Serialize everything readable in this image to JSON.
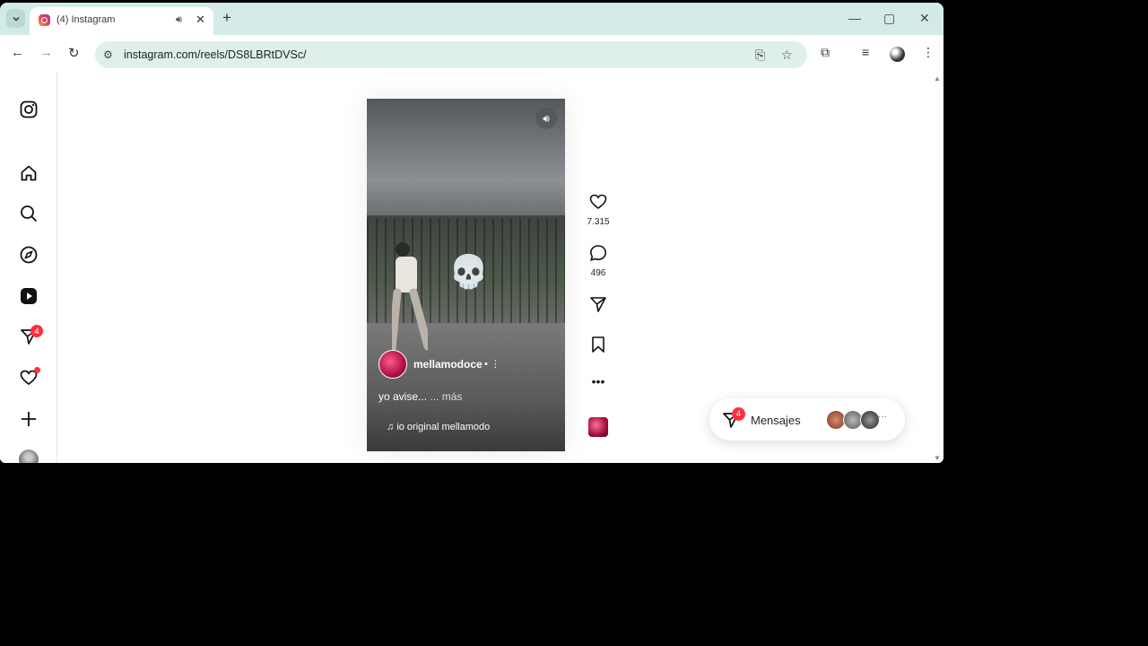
{
  "browser": {
    "tab_title": "(4) Instagram",
    "url": "instagram.com/reels/DS8LBRtDVSc/",
    "new_tab_label": "+",
    "close_tab_label": "✕",
    "audio_icon": "speaker-icon"
  },
  "sidebar": {
    "items": [
      {
        "name": "instagram-logo",
        "icon": "instagram-icon"
      },
      {
        "name": "home",
        "icon": "home-icon"
      },
      {
        "name": "search",
        "icon": "search-icon"
      },
      {
        "name": "explore",
        "icon": "compass-icon"
      },
      {
        "name": "reels",
        "icon": "reels-icon"
      },
      {
        "name": "messages",
        "icon": "send-icon"
      },
      {
        "name": "notifications",
        "icon": "heart-icon"
      },
      {
        "name": "create",
        "icon": "plus-icon"
      },
      {
        "name": "profile",
        "icon": "avatar-icon"
      }
    ],
    "messages_badge": "4"
  },
  "reel": {
    "username": "mellamodoce",
    "caption": "yo avise...",
    "more_label": "... más",
    "audio": "io original  mellamodo",
    "sticker": "💀"
  },
  "actions": {
    "likes": "7.315",
    "comments": "496"
  },
  "messages_pill": {
    "label": "Mensajes",
    "badge": "4",
    "more": "···"
  },
  "colors": {
    "tab_strip": "#d3ebe6",
    "omnibox": "#dff0ec",
    "badge": "#ff3040"
  }
}
